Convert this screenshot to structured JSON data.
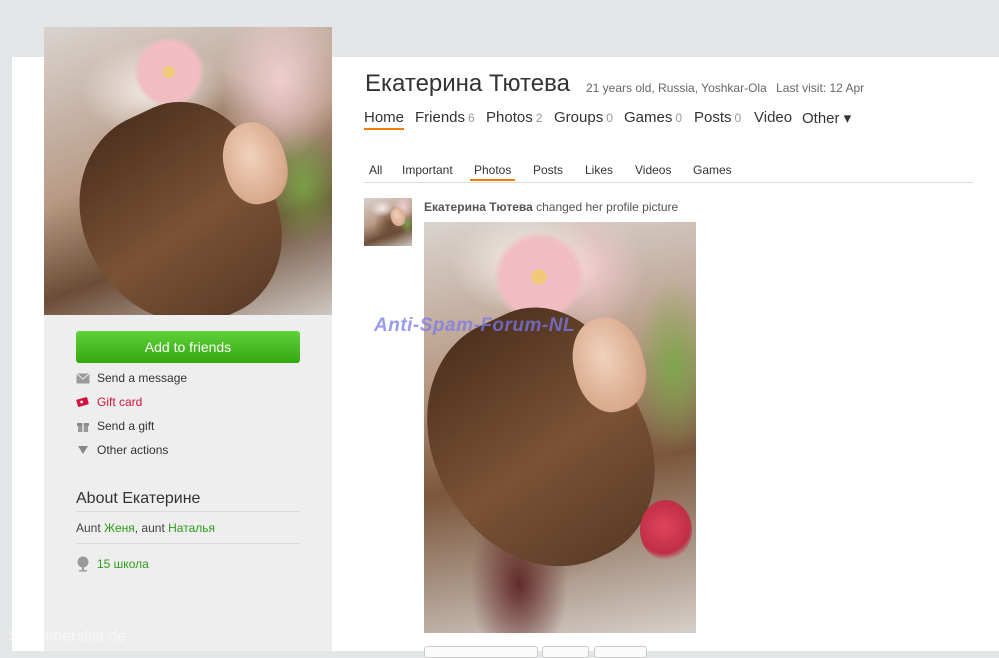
{
  "profile": {
    "name": "Екатерина Тютева",
    "meta": "21 years old, Russia, Yoshkar-Ola",
    "last_visit": "Last visit: 12 Apr"
  },
  "nav": {
    "home": "Home",
    "friends": "Friends",
    "friends_count": "6",
    "photos": "Photos",
    "photos_count": "2",
    "groups": "Groups",
    "groups_count": "0",
    "games": "Games",
    "games_count": "0",
    "posts": "Posts",
    "posts_count": "0",
    "video": "Video",
    "other": "Other ▾"
  },
  "subtabs": {
    "all": "All",
    "important": "Important",
    "photos": "Photos",
    "posts": "Posts",
    "likes": "Likes",
    "videos": "Videos",
    "games": "Games"
  },
  "sidebar": {
    "add_friends": "Add to friends",
    "send_message": "Send a message",
    "gift_card": "Gift card",
    "send_gift": "Send a gift",
    "other_actions": "Other actions"
  },
  "about": {
    "title": "About Екатерине",
    "aunt_label": "Aunt",
    "aunt1": "Женя",
    "aunt2_label": ", aunt",
    "aunt2": "Наталья",
    "school": "15 школа"
  },
  "feed": {
    "author": "Екатерина Тютева",
    "action": "changed her profile picture"
  },
  "watermarks": {
    "center": "Anti-Spam-Forum-NL",
    "bottom": "Scammerslist.de"
  },
  "colors": {
    "accent": "#f17d00",
    "button_green": "#35a80f",
    "link_green": "#2f9b1b",
    "gift_red": "#d2143a"
  }
}
